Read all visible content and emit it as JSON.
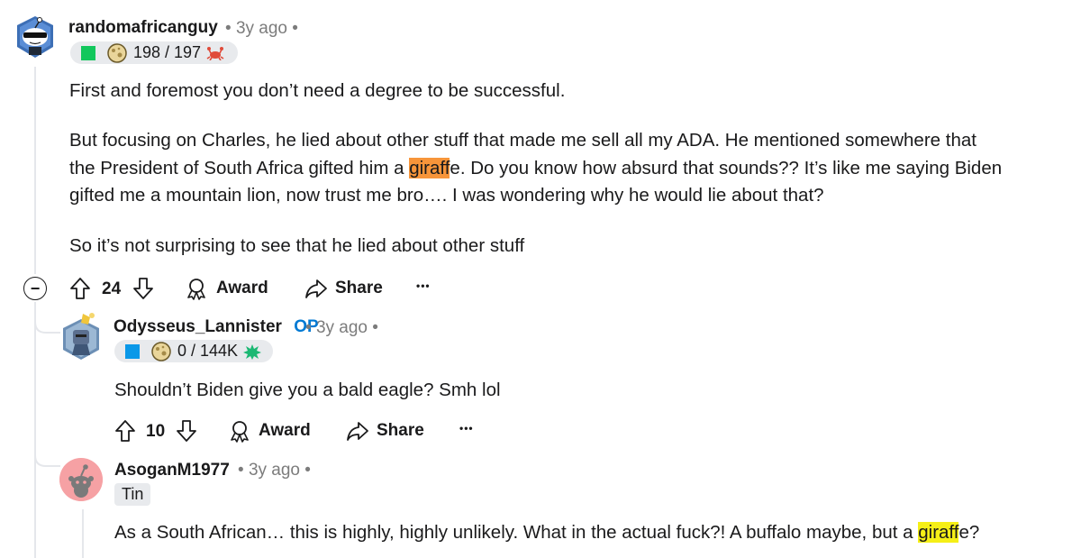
{
  "comments": [
    {
      "username": "randomafricanguy",
      "time": "3y ago",
      "flair_score": "198 / 197",
      "paragraphs": {
        "p1": "First and foremost you don’t need a degree to be successful.",
        "p2_l1": "But focusing on Charles, he lied about other stuff that made me sell all my ADA. He mentioned somewhere that",
        "p2_l2_pre": "the President of South Africa gifted him a ",
        "p2_l2_hl": "giraff",
        "p2_l2_post": "e. Do you know how absurd that sounds?? It’s like me saying Biden",
        "p2_l3": "gifted me a mountain lion, now trust me bro…. I was wondering why he would lie about that?",
        "p3": "So it’s not surprising to see that he lied about other stuff"
      },
      "votes": "24",
      "award_label": "Award",
      "share_label": "Share",
      "more_label": "•••",
      "collapse_glyph": "−",
      "flair_square_color": "#12c75c"
    },
    {
      "username": "Odysseus_Lannister",
      "op_label": "OP",
      "time": "3y ago",
      "flair_score": "0 / 144K",
      "text": "Shouldn’t Biden give you a bald eagle? Smh lol",
      "votes": "10",
      "award_label": "Award",
      "share_label": "Share",
      "more_label": "•••",
      "flair_square_color": "#0a98e8"
    },
    {
      "username": "AsoganM1977",
      "time": "3y ago",
      "flair_text": "Tin",
      "text_pre": "As a South African… this is highly, highly unlikely. What in the actual fuck?! A buffalo maybe, but a ",
      "text_hl": "giraff",
      "text_post": "e?"
    }
  ],
  "separator": "•",
  "colors": {
    "highlight_orange": "#f7953a",
    "highlight_yellow": "#f5ef17",
    "op_blue": "#0079d3",
    "meta_gray": "#7c7c7c"
  }
}
